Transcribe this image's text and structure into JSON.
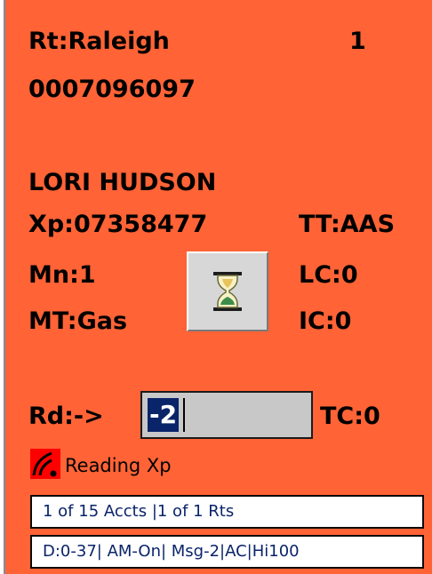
{
  "route": {
    "label": "Rt:Raleigh",
    "number": "1"
  },
  "account_number": "0007096097",
  "customer_name": "LORI HUDSON",
  "meter": {
    "xp": "Xp:07358477",
    "tt": "TT:AAS",
    "mn": "Mn:1",
    "lc": "LC:0",
    "mt": "MT:Gas",
    "ic": "IC:0"
  },
  "reading": {
    "label": "Rd:->",
    "value": "-2",
    "tc": "TC:0"
  },
  "status_text": "Reading Xp",
  "summary_line": "1 of 15 Accts |1 of 1 Rts",
  "info_line": "D:0-37| AM-On| Msg-2|AC|Hi100",
  "colors": {
    "panel_bg": "#ff6336",
    "selection": "#0a246a",
    "field_bg": "#c8c8c8"
  },
  "icons": {
    "busy": "hourglass-icon",
    "signal": "signal-icon"
  }
}
